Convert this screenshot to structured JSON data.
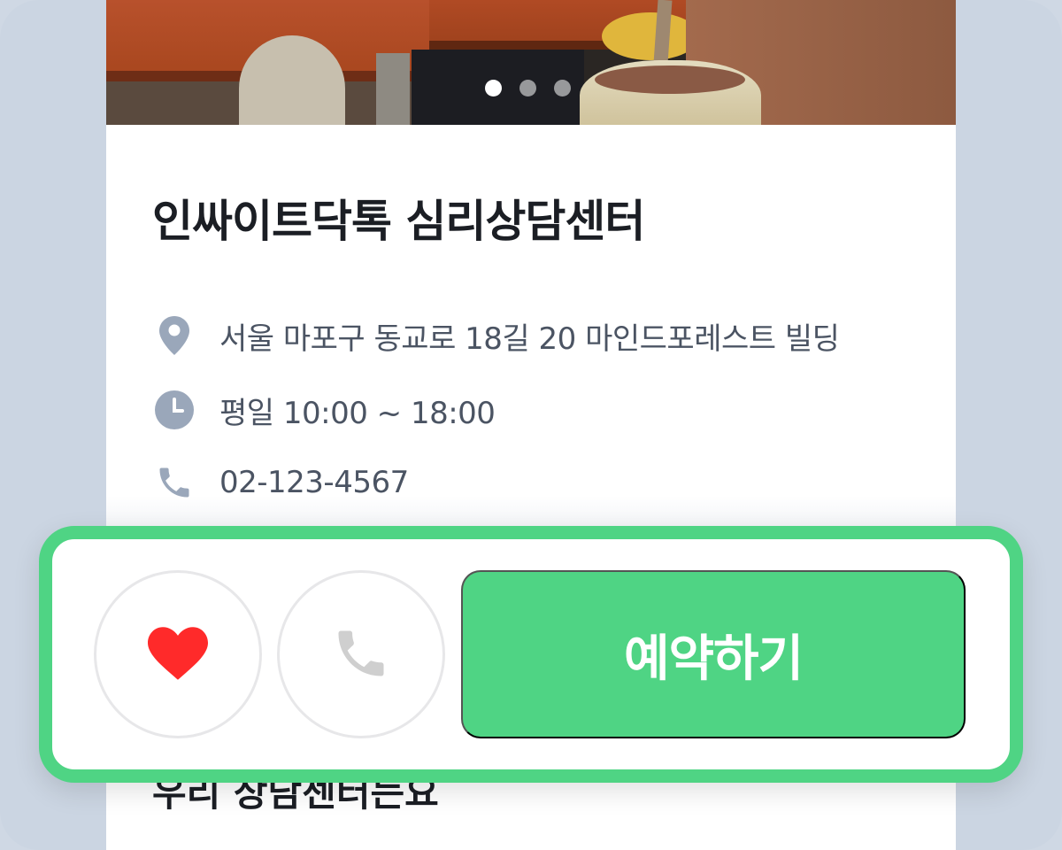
{
  "center": {
    "name": "인싸이트닥톡 심리상담센터",
    "address": "서울 마포구 동교로 18길 20 마인드포레스트 빌딩",
    "hours": "평일 10:00 ~ 18:00",
    "phone": "02-123-4567"
  },
  "gallery": {
    "slide_count": 3,
    "active_index": 0
  },
  "below_section": {
    "heading_partial": "우리 상담센터는요"
  },
  "action_bar": {
    "like_icon": "heart-icon",
    "call_icon": "phone-icon",
    "reserve_label": "예약하기"
  },
  "colors": {
    "accent": "#4fd484",
    "heart": "#ff2a2a",
    "icon_gray": "#9aa7ba",
    "phone_icon_gray": "#cfcfcf"
  },
  "icons": {
    "address": "location-pin-icon",
    "hours": "clock-icon",
    "phone": "phone-icon"
  }
}
